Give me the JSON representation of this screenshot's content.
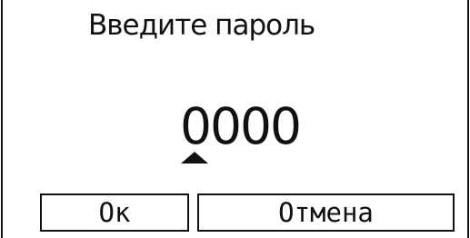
{
  "dialog": {
    "title": "Введите пароль",
    "password": {
      "digits": [
        "0",
        "0",
        "0",
        "0"
      ],
      "selected_digit": 1
    },
    "buttons": {
      "ok_label": "Ок",
      "cancel_label": "Отмена"
    }
  },
  "colors": {
    "background": "#ffffff",
    "foreground": "#111111"
  },
  "icons": {
    "cursor": "caret-up-icon"
  }
}
